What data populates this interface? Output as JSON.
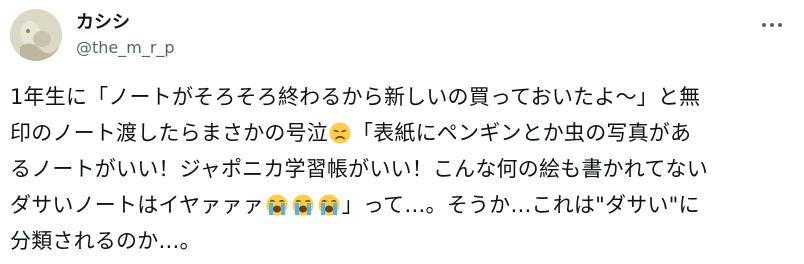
{
  "author": {
    "display_name": "カシシ",
    "handle": "@the_m_r_p"
  },
  "tweet": {
    "line1": "1年生に「ノートがそろそろ終わるから新しいの買っておいたよ〜」と無",
    "line2_a": "印のノート渡したらまさかの号泣",
    "line2_b": "「表紙にペンギンとか虫の写真があ",
    "line3": "るノートがいい！ジャポニカ学習帳がいい！こんな何の絵も書かれてない",
    "line4_a": "ダサいノートはイヤァァァ",
    "line4_b": "」って…。そうか…これは\"ダサい\"に",
    "line5": "分類されるのか…。"
  },
  "icons": {
    "more": "more-horizontal-icon",
    "sad_emoji": "disappointed-face-emoji",
    "cry_emoji": "loudly-crying-face-emoji"
  },
  "colors": {
    "text": "#0f1419",
    "secondary": "#536471",
    "emoji_face": "#ffcc4d",
    "tears": "#5dadec"
  }
}
